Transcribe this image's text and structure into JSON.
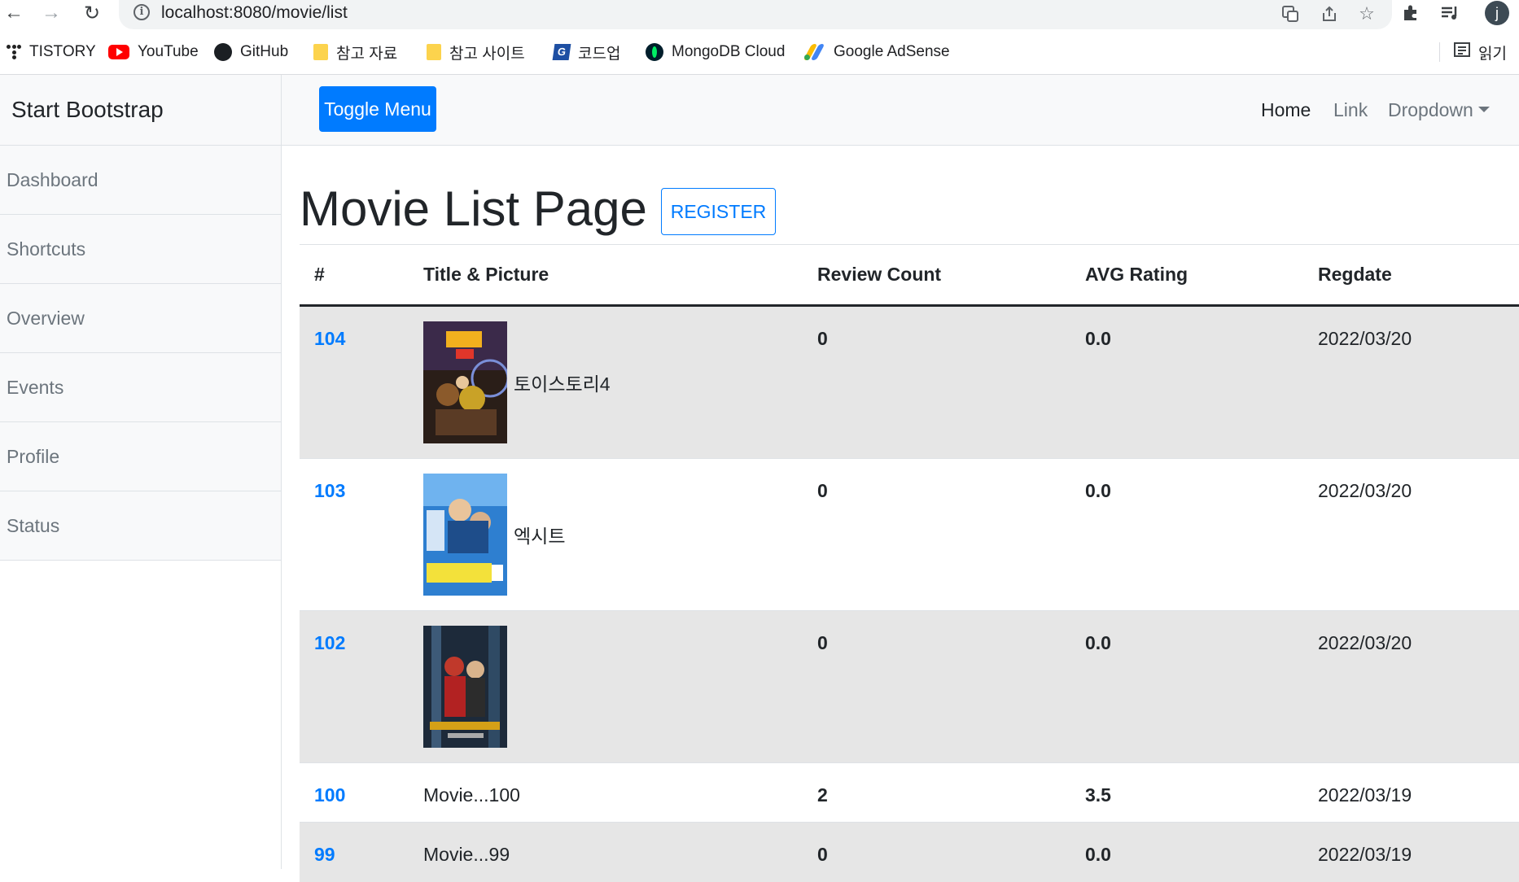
{
  "browser": {
    "url": "localhost:8080/movie/list",
    "avatar_initial": "j",
    "bookmarks": [
      {
        "label": "TISTORY",
        "icon": "tistory-dots-icon"
      },
      {
        "label": "YouTube",
        "icon": "youtube-icon"
      },
      {
        "label": "GitHub",
        "icon": "github-icon"
      },
      {
        "label": "참고 자료",
        "icon": "folder-icon"
      },
      {
        "label": "참고 사이트",
        "icon": "folder-icon"
      },
      {
        "label": "코드업",
        "icon": "codeup-icon"
      },
      {
        "label": "MongoDB Cloud",
        "icon": "mongodb-icon"
      },
      {
        "label": "Google AdSense",
        "icon": "adsense-icon"
      }
    ],
    "reading_list_label": "읽기"
  },
  "sidebar": {
    "heading": "Start Bootstrap",
    "items": [
      {
        "label": "Dashboard"
      },
      {
        "label": "Shortcuts"
      },
      {
        "label": "Overview"
      },
      {
        "label": "Events"
      },
      {
        "label": "Profile"
      },
      {
        "label": "Status"
      }
    ]
  },
  "navbar": {
    "toggle_label": "Toggle Menu",
    "links": [
      {
        "label": "Home"
      },
      {
        "label": "Link"
      },
      {
        "label": "Dropdown"
      }
    ]
  },
  "main": {
    "title": "Movie List Page",
    "register_label": "REGISTER",
    "columns": [
      "#",
      "Title & Picture",
      "Review Count",
      "AVG Rating",
      "Regdate"
    ],
    "rows": [
      {
        "id": "104",
        "title": "토이스토리4",
        "poster": "toy-story-4-poster",
        "review_count": "0",
        "avg_rating": "0.0",
        "regdate": "2022/03/20"
      },
      {
        "id": "103",
        "title": "엑시트",
        "poster": "exit-poster",
        "review_count": "0",
        "avg_rating": "0.0",
        "regdate": "2022/03/20"
      },
      {
        "id": "102",
        "title": "",
        "poster": "spiderman-poster",
        "review_count": "0",
        "avg_rating": "0.0",
        "regdate": "2022/03/20"
      },
      {
        "id": "100",
        "title": "Movie...100",
        "review_count": "2",
        "avg_rating": "3.5",
        "regdate": "2022/03/19"
      },
      {
        "id": "99",
        "title": "Movie...99",
        "review_count": "0",
        "avg_rating": "0.0",
        "regdate": "2022/03/19"
      }
    ]
  },
  "colors": {
    "primary": "#007bff",
    "sidebar_bg": "#f8f9fa",
    "stripe": "#e6e6e6"
  }
}
